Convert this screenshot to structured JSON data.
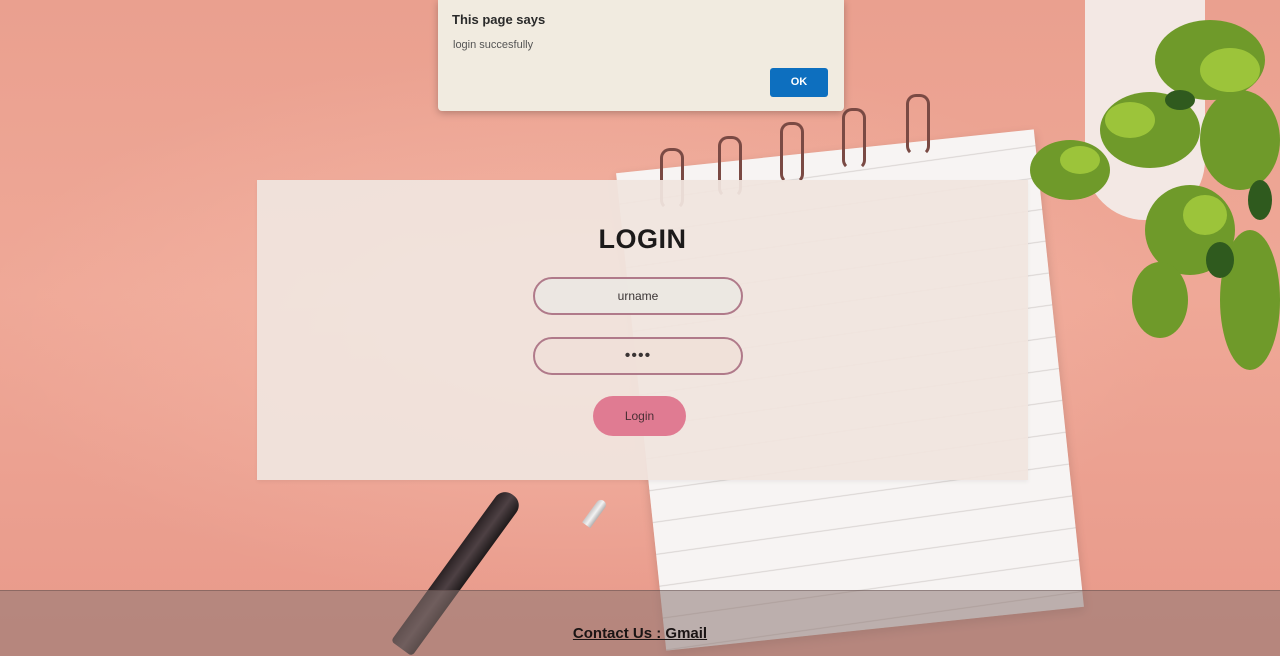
{
  "dialog": {
    "title": "This page says",
    "message": "login succesfully",
    "ok_label": "OK"
  },
  "login": {
    "title": "LOGIN",
    "username_value": "urname",
    "password_value": "••••",
    "button_label": "Login"
  },
  "footer": {
    "contact_label": "Contact Us : Gmail"
  },
  "colors": {
    "background": "#eaa08f",
    "login_button": "#e07b92",
    "dialog_ok": "#0d6fbf",
    "field_border": "#b07a8a"
  }
}
